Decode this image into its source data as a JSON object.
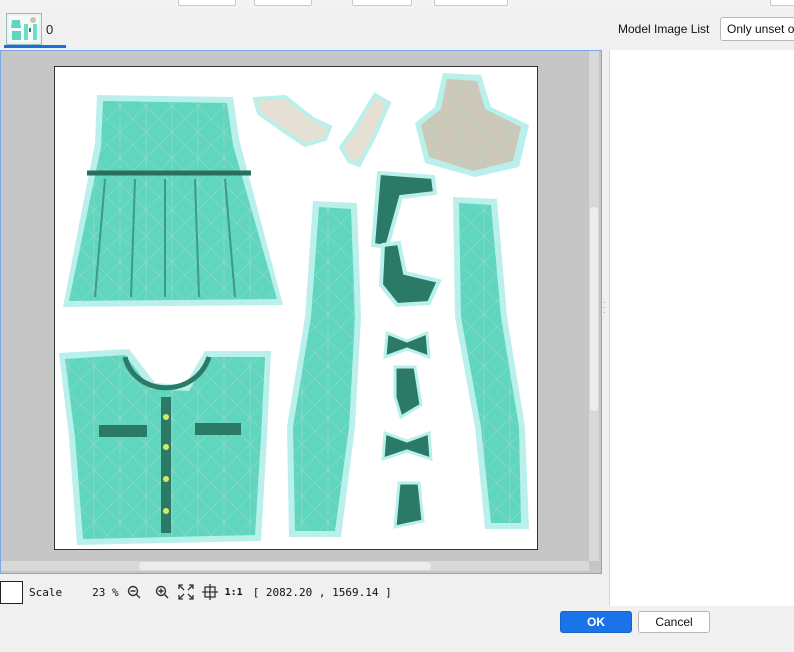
{
  "tab": {
    "count": "0",
    "thumbnail_icon": "texture-thumbnail"
  },
  "panel": {
    "title": "Model Image List",
    "filter_value": "Only unset o"
  },
  "status_bar": {
    "scale_label": "Scale",
    "zoom_percent": "23 %",
    "zoom_out_icon": "zoom-out-icon",
    "zoom_in_icon": "zoom-in-icon",
    "fit_icon": "fit-to-window-icon",
    "center_icon": "center-crosshair-icon",
    "actual_size_label": "1:1",
    "coordinates": "[ 2082.20 , 1569.14 ]"
  },
  "dialog": {
    "ok_label": "OK",
    "cancel_label": "Cancel"
  },
  "colors": {
    "accent": "#1a73e8",
    "texture_fill": "#5fd6bd",
    "texture_dark": "#2b7a68",
    "uv_outline": "#b9f0ec"
  }
}
